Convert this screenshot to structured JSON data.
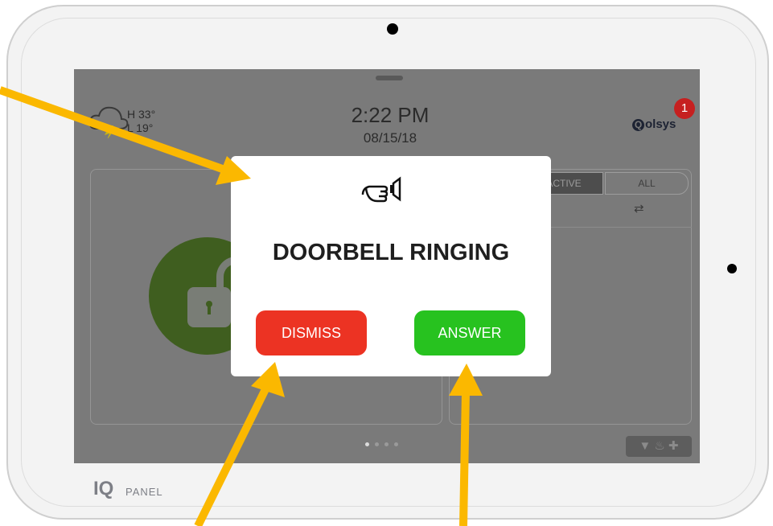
{
  "status_bar": {
    "weather_high": "H 33°",
    "weather_low": "L 19°",
    "time": "2:22 PM",
    "date": "08/15/18",
    "brand": "olsys",
    "brand_initial": "Q",
    "notification_count": "1"
  },
  "right_panel": {
    "tabs": [
      {
        "label": "ACTIVE"
      },
      {
        "label": "ALL"
      }
    ],
    "icon": "link-icon"
  },
  "page_indicator": {
    "count": 4,
    "active": 1
  },
  "bottom_icons": [
    "shield-icon",
    "fire-icon",
    "medical-icon"
  ],
  "modal": {
    "icon": "doorbell-icon",
    "title": "DOORBELL RINGING",
    "dismiss_label": "DISMISS",
    "answer_label": "ANSWER"
  },
  "device": {
    "logo_mark": "IQ",
    "logo_text": "PANEL"
  },
  "colors": {
    "dismiss": "#ec3323",
    "answer": "#27c21f",
    "arrow": "#fbb800",
    "lock": "#3f5e1f",
    "notification": "#c62020"
  }
}
